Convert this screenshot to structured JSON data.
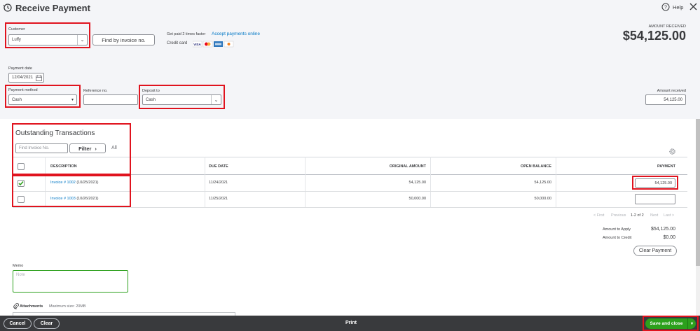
{
  "header": {
    "title": "Receive Payment",
    "help_label": "Help"
  },
  "customer": {
    "label": "Customer",
    "value": "Luffy",
    "find_button": "Find by invoice no."
  },
  "promo": {
    "text": "Get paid 2 times faster",
    "link": "Accept payments online",
    "credit_label": "Credit card"
  },
  "amount_received_top": {
    "label": "AMOUNT RECEIVED",
    "value": "$54,125.00"
  },
  "payment_date": {
    "label": "Payment date",
    "value": "12/04/2021"
  },
  "payment_method": {
    "label": "Payment method",
    "value": "Cash"
  },
  "reference": {
    "label": "Reference no.",
    "value": ""
  },
  "deposit_to": {
    "label": "Deposit to",
    "value": "Cash"
  },
  "amount_received": {
    "label": "Amount received",
    "value": "54,125.00"
  },
  "outstanding": {
    "title": "Outstanding Transactions",
    "find_placeholder": "Find Invoice No.",
    "filter_label": "Filter",
    "all_label": "All"
  },
  "table": {
    "headers": {
      "description": "DESCRIPTION",
      "due_date": "DUE DATE",
      "original_amount": "ORIGINAL AMOUNT",
      "open_balance": "OPEN BALANCE",
      "payment": "PAYMENT"
    },
    "rows": [
      {
        "checked": true,
        "invoice_link": "Invoice # 1002",
        "invoice_date": "(10/25/2021)",
        "due_date": "11/24/2021",
        "original_amount": "54,125.00",
        "open_balance": "54,125.00",
        "payment": "54,125.00"
      },
      {
        "checked": false,
        "invoice_link": "Invoice # 1003",
        "invoice_date": "(10/26/2021)",
        "due_date": "11/25/2021",
        "original_amount": "50,000.00",
        "open_balance": "50,000.00",
        "payment": ""
      }
    ]
  },
  "pagination": {
    "first": "< First",
    "previous": "Previous",
    "range": "1-2 of 2",
    "next": "Next",
    "last": "Last >"
  },
  "totals": {
    "apply_label": "Amount to Apply",
    "apply_value": "$54,125.00",
    "credit_label": "Amount to Credit",
    "credit_value": "$0.00",
    "clear_payment": "Clear Payment"
  },
  "memo": {
    "label": "Memo",
    "placeholder": "Note"
  },
  "attachments": {
    "label": "Attachments",
    "max_size": "Maximum size: 20MB"
  },
  "footer": {
    "cancel": "Cancel",
    "clear": "Clear",
    "print": "Print",
    "save_close": "Save and close"
  }
}
